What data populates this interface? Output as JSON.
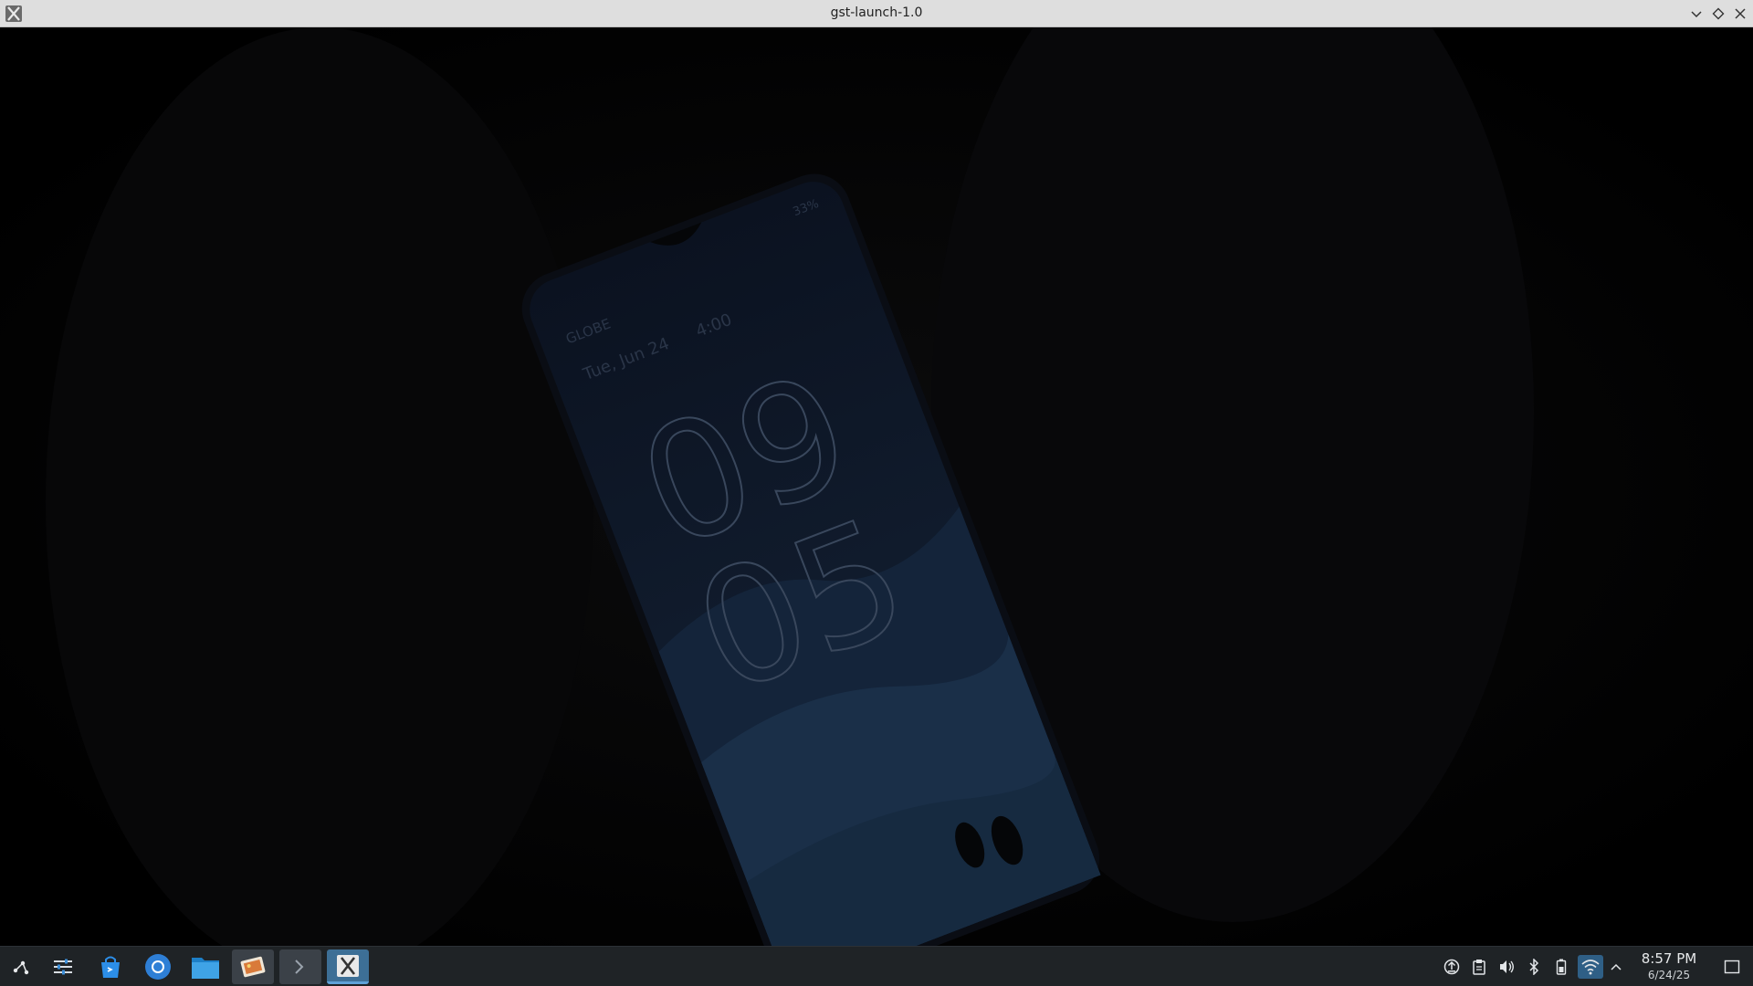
{
  "window": {
    "title": "gst-launch-1.0",
    "app_icon": "x-logo-icon",
    "controls": [
      "chevron-down-icon",
      "diamond-restore-icon",
      "close-icon"
    ]
  },
  "video": {
    "phone_lockscreen": {
      "carrier": "GLOBE",
      "date": "Tue, Jun 24",
      "alarm": "4:00",
      "battery": "33%",
      "clock_hours": "09",
      "clock_minutes": "05"
    }
  },
  "taskbar": {
    "launcher_icon": "app-launcher-icon",
    "apps": [
      {
        "name": "system-settings",
        "icon": "sliders-icon"
      },
      {
        "name": "discover",
        "icon": "shopping-bag-icon"
      },
      {
        "name": "chromium",
        "icon": "browser-icon"
      },
      {
        "name": "file-manager",
        "icon": "folder-icon"
      },
      {
        "name": "media-viewer",
        "icon": "image-viewer-icon"
      },
      {
        "name": "terminal",
        "icon": "terminal-icon"
      },
      {
        "name": "gst-launch",
        "icon": "x-logo-icon"
      }
    ],
    "tray": [
      "update-icon",
      "clipboard-icon",
      "volume-icon",
      "bluetooth-icon",
      "battery-icon",
      "wifi-icon",
      "chevron-up-icon"
    ],
    "clock": {
      "time": "8:57 PM",
      "date": "6/24/25"
    },
    "colors": {
      "bar": "#1f2326",
      "active": "#3d6f96",
      "accent": "#5ea1d8"
    }
  }
}
